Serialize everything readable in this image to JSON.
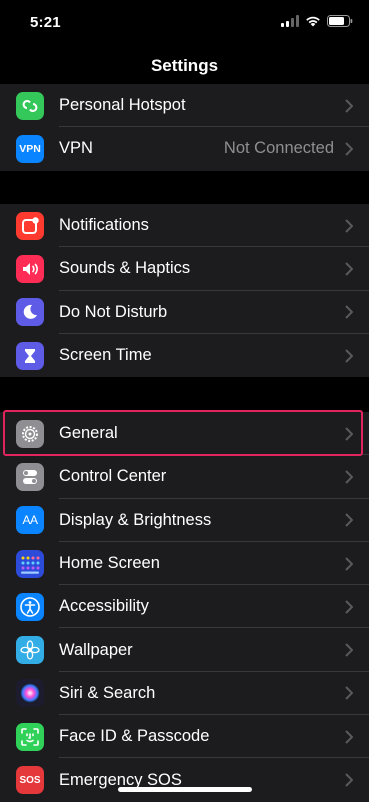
{
  "status_bar": {
    "time": "5:21"
  },
  "nav": {
    "title": "Settings"
  },
  "group1": [
    {
      "label": "Personal Hotspot",
      "icon": "hotspot-icon",
      "color": "#34c759"
    },
    {
      "label": "VPN",
      "icon": "vpn-icon",
      "icon_text": "VPN",
      "color": "#0a84ff",
      "value": "Not Connected"
    }
  ],
  "group2": [
    {
      "label": "Notifications",
      "icon": "notifications-icon",
      "color": "#ff3b30"
    },
    {
      "label": "Sounds & Haptics",
      "icon": "speaker-icon",
      "color": "#ff2d55"
    },
    {
      "label": "Do Not Disturb",
      "icon": "moon-icon",
      "color": "#5e5ce6"
    },
    {
      "label": "Screen Time",
      "icon": "hourglass-icon",
      "color": "#5e5ce6"
    }
  ],
  "group3": [
    {
      "label": "General",
      "icon": "gear-icon",
      "color": "#8e8e93"
    },
    {
      "label": "Control Center",
      "icon": "toggles-icon",
      "color": "#8e8e93"
    },
    {
      "label": "Display & Brightness",
      "icon": "display-icon",
      "icon_text": "AA",
      "color": "#0a84ff"
    },
    {
      "label": "Home Screen",
      "icon": "home-grid-icon",
      "color": "#2c4bd8"
    },
    {
      "label": "Accessibility",
      "icon": "accessibility-icon",
      "color": "#0a84ff"
    },
    {
      "label": "Wallpaper",
      "icon": "flower-icon",
      "color": "#32ade6"
    },
    {
      "label": "Siri & Search",
      "icon": "siri-icon",
      "color": "#1c1c2e"
    },
    {
      "label": "Face ID & Passcode",
      "icon": "face-id-icon",
      "color": "#30d158"
    },
    {
      "label": "Emergency SOS",
      "icon": "sos-icon",
      "icon_text": "SOS",
      "color": "#e5383b"
    }
  ],
  "colors": {
    "highlight": "#e0245e",
    "background": "#000000",
    "cell": "#1c1c1e"
  }
}
